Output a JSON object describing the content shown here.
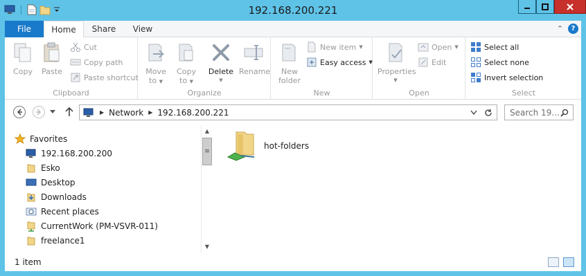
{
  "window": {
    "title": "192.168.200.221"
  },
  "tabs": {
    "file": "File",
    "home": "Home",
    "share": "Share",
    "view": "View"
  },
  "ribbon": {
    "clipboard": {
      "label": "Clipboard",
      "copy": "Copy",
      "paste": "Paste",
      "cut": "Cut",
      "copy_path": "Copy path",
      "paste_shortcut": "Paste shortcut"
    },
    "organize": {
      "label": "Organize",
      "move_to": "Move",
      "move_to_2": "to",
      "copy_to": "Copy",
      "copy_to_2": "to",
      "delete": "Delete",
      "rename": "Rename"
    },
    "new": {
      "label": "New",
      "new_folder": "New",
      "new_folder_2": "folder",
      "new_item": "New item",
      "easy_access": "Easy access"
    },
    "open": {
      "label": "Open",
      "properties": "Properties",
      "open": "Open",
      "edit": "Edit"
    },
    "select": {
      "label": "Select",
      "select_all": "Select all",
      "select_none": "Select none",
      "invert_selection": "Invert selection"
    }
  },
  "address": {
    "crumbs": [
      "Network",
      "192.168.200.221"
    ],
    "search_placeholder": "Search 19..."
  },
  "navpane": {
    "favorites": "Favorites",
    "items": [
      "192.168.200.200",
      "Esko",
      "Desktop",
      "Downloads",
      "Recent places",
      "CurrentWork (PM-VSVR-011)",
      "freelance1"
    ]
  },
  "content": {
    "items": [
      "hot-folders"
    ]
  },
  "status": {
    "count": "1 item"
  },
  "colors": {
    "titlebar": "#5fc3e8",
    "file_tab": "#1979ca",
    "close_button": "#c7302b"
  }
}
